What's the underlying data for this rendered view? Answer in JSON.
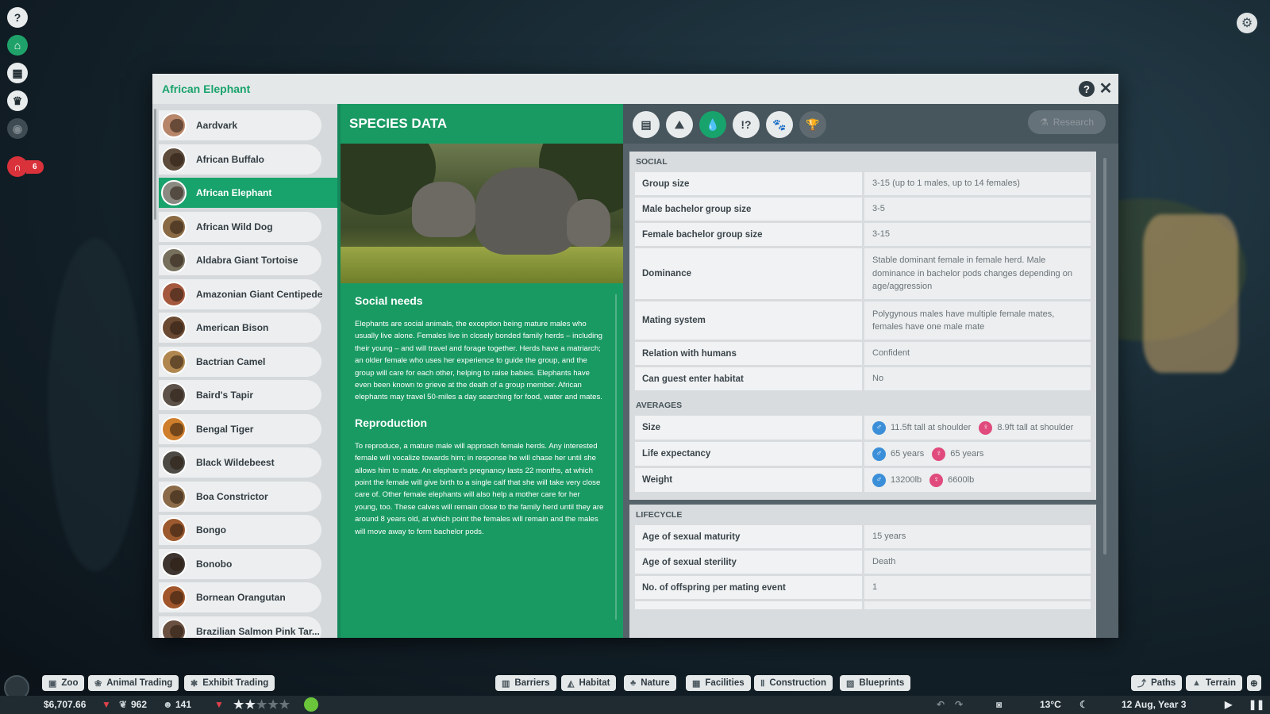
{
  "window": {
    "title": "African Elephant"
  },
  "species_list": [
    {
      "name": "Aardvark",
      "color": "#b7866a"
    },
    {
      "name": "African Buffalo",
      "color": "#5d4b3c"
    },
    {
      "name": "African Elephant",
      "color": "#8a8a82",
      "selected": true
    },
    {
      "name": "African Wild Dog",
      "color": "#8a6a45"
    },
    {
      "name": "Aldabra Giant Tortoise",
      "color": "#76705d"
    },
    {
      "name": "Amazonian Giant Centipede",
      "color": "#a4593e"
    },
    {
      "name": "American Bison",
      "color": "#6b4a33"
    },
    {
      "name": "Bactrian Camel",
      "color": "#b0874f"
    },
    {
      "name": "Baird's Tapir",
      "color": "#5c5249"
    },
    {
      "name": "Bengal Tiger",
      "color": "#cf7e2c"
    },
    {
      "name": "Black Wildebeest",
      "color": "#4d4a45"
    },
    {
      "name": "Boa Constrictor",
      "color": "#8a6a48"
    },
    {
      "name": "Bongo",
      "color": "#9c5a2e"
    },
    {
      "name": "Bonobo",
      "color": "#3e3530"
    },
    {
      "name": "Bornean Orangutan",
      "color": "#a0552a"
    },
    {
      "name": "Brazilian Salmon Pink Tar...",
      "color": "#6a5040"
    }
  ],
  "species_data": {
    "title": "SPECIES DATA",
    "tabs": [
      {
        "icon": "clipboard-icon",
        "glyph": "▤"
      },
      {
        "icon": "habitat-icon",
        "glyph": "⛰"
      },
      {
        "icon": "water-drop-icon",
        "glyph": "💧",
        "active": true
      },
      {
        "icon": "alert-question-icon",
        "glyph": "!?"
      },
      {
        "icon": "paw-icon",
        "glyph": "🐾"
      },
      {
        "icon": "trophy-icon",
        "glyph": "🏆",
        "disabled": true
      }
    ],
    "research_label": "Research"
  },
  "text": {
    "social_heading": "Social needs",
    "social_body": "Elephants are social animals, the exception being mature males who usually live alone. Females live in closely bonded family herds – including their young – and will travel and forage together. Herds have a matriarch; an older female who uses her experience to guide the group, and the group will care for each other, helping to raise babies. Elephants have even been known to grieve at the death of a group member. African elephants may travel 50-miles a day searching for food, water and mates.",
    "repro_heading": "Reproduction",
    "repro_body": "To reproduce, a mature male will approach female herds. Any interested female will vocalize towards him; in response he will chase her until she allows him to mate. An elephant's pregnancy lasts 22 months, at which point the female will give birth to a single calf that she will take very close care of. Other female elephants will also help a mother care for her young, too. These calves will remain close to the family herd until they are around 8 years old, at which point the females will remain and the males will move away to form bachelor pods."
  },
  "social": {
    "title": "SOCIAL",
    "rows": [
      {
        "k": "Group size",
        "v": "3-15 (up to 1 males, up to 14 females)"
      },
      {
        "k": "Male bachelor group size",
        "v": "3-5"
      },
      {
        "k": "Female bachelor group size",
        "v": "3-15"
      },
      {
        "k": "Dominance",
        "v": "Stable dominant female in female herd. Male dominance in bachelor pods changes depending on age/aggression",
        "tall": 3
      },
      {
        "k": "Mating system",
        "v": "Polygynous males have multiple female mates, females have one male mate",
        "tall": 2
      },
      {
        "k": "Relation with humans",
        "v": "Confident"
      },
      {
        "k": "Can guest enter habitat",
        "v": "No"
      }
    ]
  },
  "averages": {
    "title": "AVERAGES",
    "rows": [
      {
        "k": "Size",
        "male": "11.5ft tall at shoulder",
        "female": "8.9ft tall at shoulder"
      },
      {
        "k": "Life expectancy",
        "male": "65 years",
        "female": "65 years"
      },
      {
        "k": "Weight",
        "male": "13200lb",
        "female": "6600lb"
      }
    ]
  },
  "lifecycle": {
    "title": "LIFECYCLE",
    "rows": [
      {
        "k": "Age of sexual maturity",
        "v": "15 years"
      },
      {
        "k": "Age of sexual sterility",
        "v": "Death"
      },
      {
        "k": "No. of offspring per mating event",
        "v": "1"
      }
    ]
  },
  "bottom": {
    "left_buttons": [
      "Zoo",
      "Animal Trading",
      "Exhibit Trading"
    ],
    "center_buttons": [
      "Barriers",
      "Habitat",
      "Nature",
      "Facilities",
      "Construction",
      "Blueprints"
    ],
    "right_buttons": [
      "Paths",
      "Terrain"
    ]
  },
  "status": {
    "money": "$6,707.66",
    "conservation": "962",
    "guests": "141",
    "temperature": "13°C",
    "date": "12 Aug, Year 3",
    "rating": 2
  },
  "hud": {
    "alerts_count": "6"
  }
}
